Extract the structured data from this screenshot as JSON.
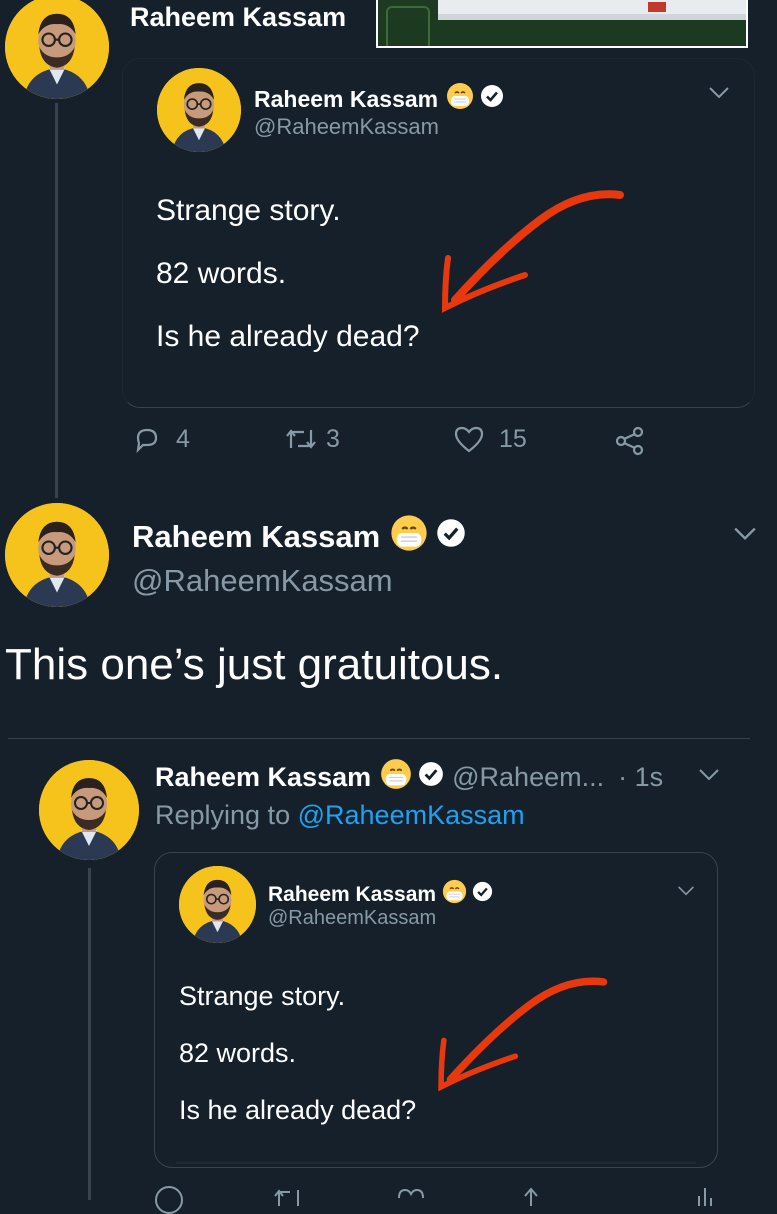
{
  "top_tweet": {
    "name": "Raheem Kassam"
  },
  "quoted_1": {
    "name": "Raheem Kassam",
    "handle": "@RaheemKassam",
    "lines": [
      "Strange story.",
      "82 words.",
      "Is he already dead?"
    ]
  },
  "actions_1": {
    "reply_count": "4",
    "retweet_count": "3",
    "like_count": "15"
  },
  "main_tweet": {
    "name": "Raheem Kassam",
    "handle": "@RaheemKassam",
    "text": "This one’s just gratuitous."
  },
  "reply_tweet": {
    "name": "Raheem Kassam",
    "handle": "@Raheem...",
    "time": "· 1s",
    "replying_prefix": "Replying to",
    "replying_handle": "@RaheemKassam"
  },
  "quoted_2": {
    "name": "Raheem Kassam",
    "handle": "@RaheemKassam",
    "lines": [
      "Strange story.",
      "82 words.",
      "Is he already dead?"
    ]
  },
  "colors": {
    "background": "#15202b",
    "accent": "#1da1f2",
    "annotation_arrow": "#e8380d",
    "avatar_bg": "#f6c31c"
  }
}
